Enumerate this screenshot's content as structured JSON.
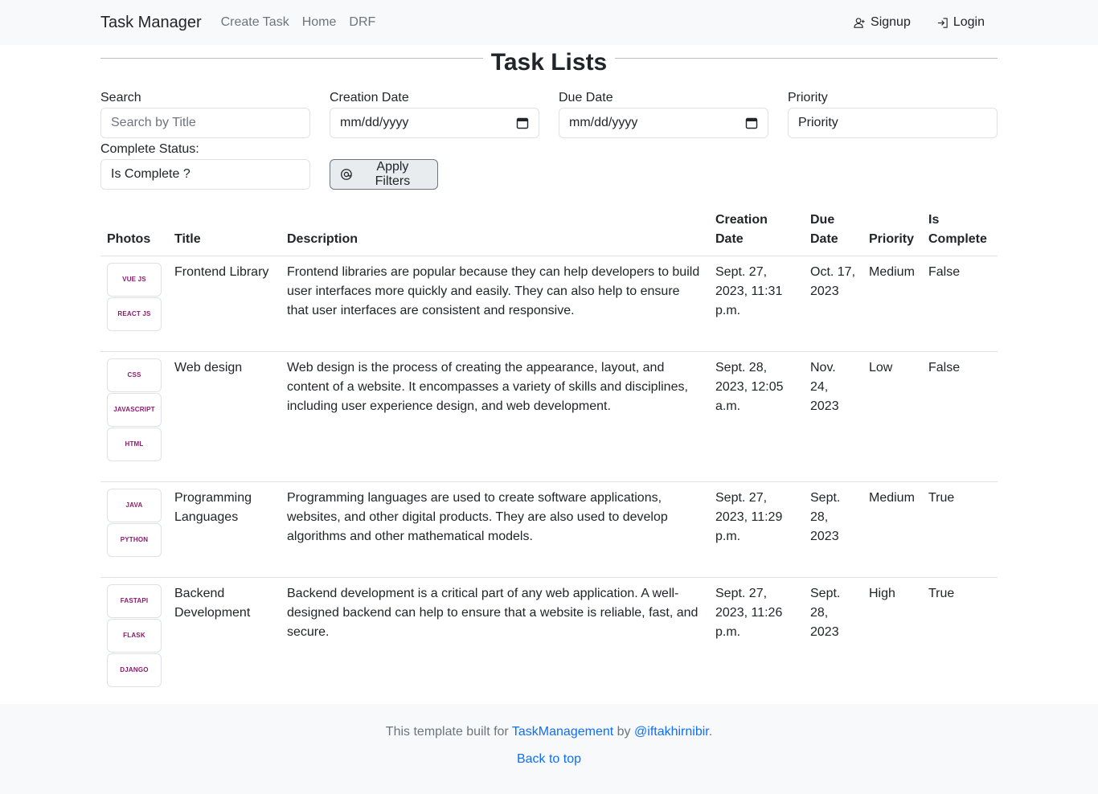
{
  "navbar": {
    "brand": "Task Manager",
    "links": [
      "Create Task",
      "Home",
      "DRF"
    ],
    "signup": "Signup",
    "login": "Login"
  },
  "page_title": "Task Lists",
  "filters": {
    "search": {
      "label": "Search",
      "placeholder": "Search by Title"
    },
    "creation_date": {
      "label": "Creation Date",
      "placeholder": "mm/dd/yyyy"
    },
    "due_date": {
      "label": "Due Date",
      "placeholder": "mm/dd/yyyy"
    },
    "priority": {
      "label": "Priority",
      "placeholder": "Priority"
    },
    "complete_status": {
      "label": "Complete Status:",
      "placeholder": "Is Complete ?"
    },
    "apply_button": "Apply Filters"
  },
  "table": {
    "headers": [
      "Photos",
      "Title",
      "Description",
      "Creation Date",
      "Due Date",
      "Priority",
      "Is Complete"
    ],
    "rows": [
      {
        "photos": [
          "VUE JS",
          "REACT JS"
        ],
        "title": "Frontend Library",
        "description": "Frontend libraries are popular because they can help developers to build user interfaces more quickly and easily. They can also help to ensure that user interfaces are consistent and responsive.",
        "creation_date": "Sept. 27, 2023, 11:31 p.m.",
        "due_date": "Oct. 17, 2023",
        "priority": "Medium",
        "is_complete": "False"
      },
      {
        "photos": [
          "CSS",
          "JAVASCRIPT",
          "HTML"
        ],
        "title": "Web design",
        "description": "Web design is the process of creating the appearance, layout, and content of a website. It encompasses a variety of skills and disciplines, including user experience design, and web development.",
        "creation_date": "Sept. 28, 2023, 12:05 a.m.",
        "due_date": "Nov. 24, 2023",
        "priority": "Low",
        "is_complete": "False"
      },
      {
        "photos": [
          "JAVA",
          "PYTHON"
        ],
        "title": "Programming Languages",
        "description": "Programming languages are used to create software applications, websites, and other digital products. They are also used to develop algorithms and other mathematical models.",
        "creation_date": "Sept. 27, 2023, 11:29 p.m.",
        "due_date": "Sept. 28, 2023",
        "priority": "Medium",
        "is_complete": "True"
      },
      {
        "photos": [
          "FASTAPI",
          "FLASK",
          "DJANGO"
        ],
        "title": "Backend Development",
        "description": "Backend development is a critical part of any web application. A well-designed backend can help to ensure that a website is reliable, fast, and secure.",
        "creation_date": "Sept. 27, 2023, 11:26 p.m.",
        "due_date": "Sept. 28, 2023",
        "priority": "High",
        "is_complete": "True"
      }
    ]
  },
  "footer": {
    "prefix": "This template built for",
    "project_link": "TaskManagement",
    "by": "by",
    "author_link": "@iftakhirnibir",
    "suffix": ".",
    "back_to_top": "Back to top"
  },
  "colors": {
    "link": "#0d6efd",
    "muted": "#6c757d",
    "navbar_bg": "#f8f9fa",
    "logo_text": "#8b1a6b"
  }
}
